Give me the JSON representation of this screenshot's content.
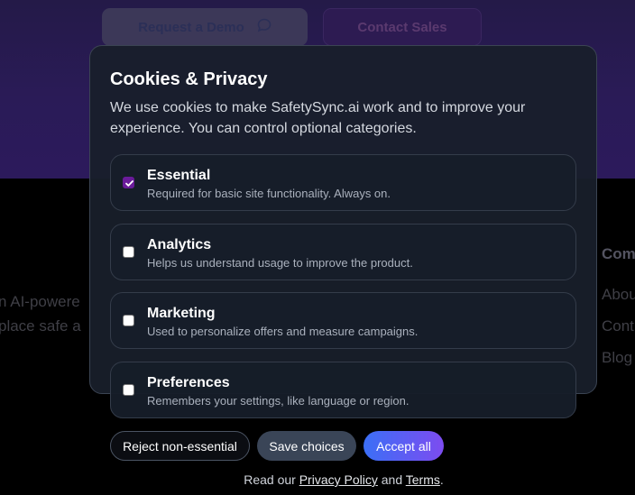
{
  "hero": {
    "demo_label": "Request a Demo",
    "sales_label": "Contact Sales"
  },
  "footer": {
    "tagline_line1": "n AI-powere",
    "tagline_line2": "place safe a",
    "company_heading": "Com",
    "links": [
      "Abou",
      "Cont",
      "Blog"
    ]
  },
  "modal": {
    "title": "Cookies & Privacy",
    "description": "We use cookies to make SafetySync.ai work and to improve your experience. You can control optional categories.",
    "categories": [
      {
        "name": "Essential",
        "description": "Required for basic site functionality. Always on.",
        "checked": true
      },
      {
        "name": "Analytics",
        "description": "Helps us understand usage to improve the product.",
        "checked": false
      },
      {
        "name": "Marketing",
        "description": "Used to personalize offers and measure campaigns.",
        "checked": false
      },
      {
        "name": "Preferences",
        "description": "Remembers your settings, like language or region.",
        "checked": false
      }
    ],
    "buttons": {
      "reject": "Reject non-essential",
      "save": "Save choices",
      "accept": "Accept all"
    },
    "legal": {
      "prefix": "Read our",
      "privacy": "Privacy Policy",
      "and": "and",
      "terms": "Terms",
      "suffix": "."
    }
  },
  "colors": {
    "accent_check": "#6a1b9a",
    "accept_gradient_start": "#3b6ff6",
    "accept_gradient_end": "#7d4cf0"
  }
}
